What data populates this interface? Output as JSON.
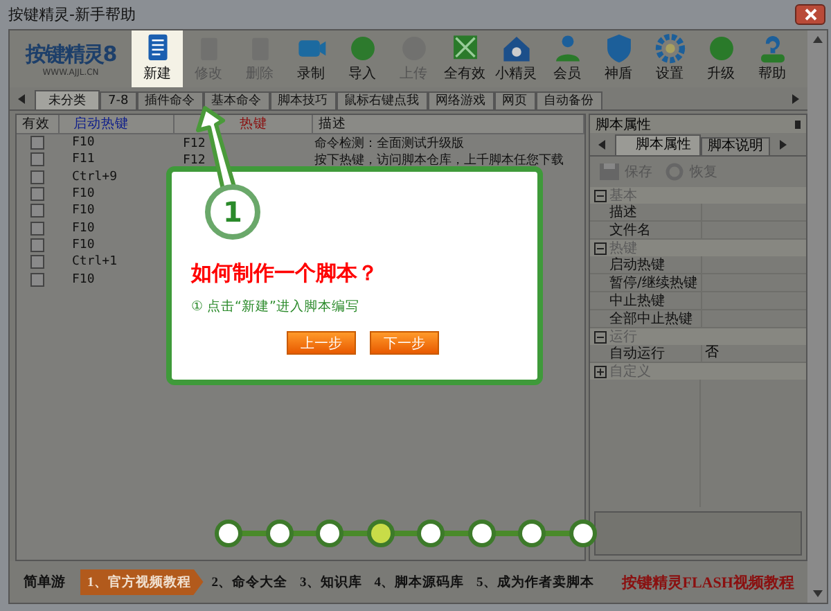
{
  "window": {
    "title": "按键精灵-新手帮助"
  },
  "toolbar": {
    "logo": {
      "title": "按键精灵8",
      "url": "WWW.AJJL.CN"
    },
    "buttons": [
      {
        "kind": "new",
        "label": "新建",
        "disabled": false,
        "selected": true
      },
      {
        "kind": "edit",
        "label": "修改",
        "disabled": true,
        "selected": false
      },
      {
        "kind": "delete",
        "label": "删除",
        "disabled": true,
        "selected": false
      },
      {
        "kind": "record",
        "label": "录制",
        "disabled": false,
        "selected": false
      },
      {
        "kind": "import",
        "label": "导入",
        "disabled": false,
        "selected": false
      },
      {
        "kind": "upload",
        "label": "上传",
        "disabled": true,
        "selected": false
      },
      {
        "kind": "all",
        "label": "全有效",
        "disabled": false,
        "selected": false
      },
      {
        "kind": "sprite",
        "label": "小精灵",
        "disabled": false,
        "selected": false
      },
      {
        "kind": "member",
        "label": "会员",
        "disabled": false,
        "selected": false
      },
      {
        "kind": "shield",
        "label": "神盾",
        "disabled": false,
        "selected": false
      },
      {
        "kind": "settings",
        "label": "设置",
        "disabled": false,
        "selected": false
      },
      {
        "kind": "upgrade",
        "label": "升级",
        "disabled": false,
        "selected": false
      },
      {
        "kind": "help",
        "label": "帮助",
        "disabled": false,
        "selected": false
      }
    ]
  },
  "tabs": [
    {
      "label": "未分类",
      "selected": true
    },
    {
      "label": "7-8",
      "selected": false
    },
    {
      "label": "插件命令",
      "selected": false
    },
    {
      "label": "基本命令",
      "selected": false
    },
    {
      "label": "脚本技巧",
      "selected": false
    },
    {
      "label": "鼠标右键点我",
      "selected": false
    },
    {
      "label": "网络游戏",
      "selected": false
    },
    {
      "label": "网页",
      "selected": false
    },
    {
      "label": "自动备份",
      "selected": false
    }
  ],
  "table": {
    "columns": [
      "有效",
      "启动热键",
      "热键",
      "描述"
    ],
    "rows": [
      {
        "checked": false,
        "hotkey": "F10",
        "stop_hotkey": "F12",
        "description": "命令检测：全面测试升级版"
      },
      {
        "checked": false,
        "hotkey": "F11",
        "stop_hotkey": "F12",
        "description": "按下热键，访问脚本仓库，上千脚本任您下载"
      },
      {
        "checked": false,
        "hotkey": "Ctrl+9"
      },
      {
        "checked": false,
        "hotkey": "F10"
      },
      {
        "checked": false,
        "hotkey": "F10"
      },
      {
        "checked": false,
        "hotkey": "F10"
      },
      {
        "checked": false,
        "hotkey": "F10"
      },
      {
        "checked": false,
        "hotkey": "Ctrl+1"
      },
      {
        "checked": false,
        "hotkey": "F10"
      }
    ]
  },
  "properties": {
    "title": "脚本属性",
    "tabs": [
      {
        "label": "脚本属性",
        "selected": true
      },
      {
        "label": "脚本说明",
        "selected": false
      }
    ],
    "actions": [
      {
        "kind": "save",
        "label": "保存"
      },
      {
        "kind": "restore",
        "label": "恢复"
      }
    ],
    "groups": [
      {
        "name": "基本",
        "expanded": true,
        "items": [
          {
            "name": "描述"
          },
          {
            "name": "文件名"
          }
        ]
      },
      {
        "name": "热键",
        "expanded": true,
        "items": [
          {
            "name": "启动热键"
          },
          {
            "name": "暂停/继续热键"
          },
          {
            "name": "中止热键"
          },
          {
            "name": "全部中止热键"
          }
        ]
      },
      {
        "name": "运行",
        "expanded": true,
        "items": [
          {
            "name": "自动运行",
            "value": "否"
          }
        ]
      },
      {
        "name": "自定义",
        "expanded": false
      }
    ]
  },
  "guide": {
    "step_number": "1",
    "title": "如何制作一个脚本？",
    "instruction": "① 点击“新建”进入脚本编写",
    "buttons": [
      "上一步",
      "下一步"
    ],
    "steps": [
      {
        "selected": false
      },
      {
        "selected": false
      },
      {
        "selected": false
      },
      {
        "selected": true
      },
      {
        "selected": false
      },
      {
        "selected": false
      },
      {
        "selected": false
      },
      {
        "selected": false
      }
    ]
  },
  "bottom_bar": {
    "logo": "简单游",
    "links": [
      {
        "label": "1、官方视频教程",
        "selected": true
      },
      {
        "label": "2、命令大全",
        "selected": false
      },
      {
        "label": "3、知识库",
        "selected": false
      },
      {
        "label": "4、脚本源码库",
        "selected": false
      },
      {
        "label": "5、成为作者卖脚本",
        "selected": false
      }
    ],
    "promo": "按键精灵FLASH视频教程"
  }
}
